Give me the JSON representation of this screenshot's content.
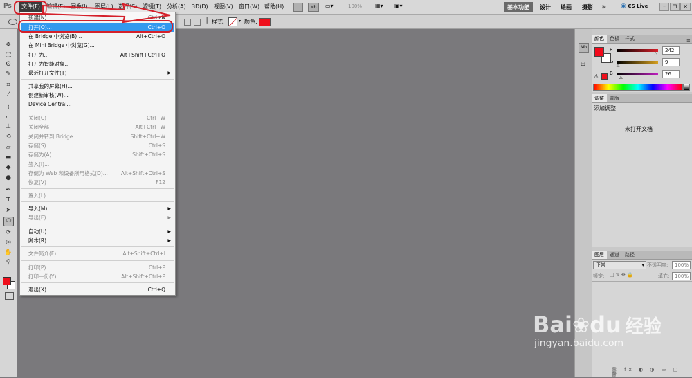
{
  "menubar": {
    "logo": "Ps",
    "menus": [
      "文件(F)",
      "编辑(E)",
      "图像(I)",
      "图层(L)",
      "选择(S)",
      "滤镜(T)",
      "分析(A)",
      "3D(D)",
      "视图(V)",
      "窗口(W)",
      "帮助(H)"
    ],
    "mb_label": "Mb",
    "zoom": "100%",
    "workspaces": [
      "基本功能",
      "设计",
      "绘画",
      "摄影"
    ],
    "more": "»",
    "cs_live": "CS Live"
  },
  "options_bar": {
    "style_label": "样式:",
    "color_label": "颜色:"
  },
  "file_menu": {
    "items": [
      {
        "label": "新建(N)...",
        "shortcut": "Ctrl+N",
        "disabled": false
      },
      {
        "label": "打开(O)...",
        "shortcut": "Ctrl+O",
        "disabled": false
      },
      {
        "label": "在 Bridge 中浏览(B)...",
        "shortcut": "Alt+Ctrl+O",
        "disabled": false
      },
      {
        "label": "在 Mini Bridge 中浏览(G)...",
        "shortcut": "",
        "disabled": false
      },
      {
        "label": "打开为...",
        "shortcut": "Alt+Shift+Ctrl+O",
        "disabled": false
      },
      {
        "label": "打开为智能对象...",
        "shortcut": "",
        "disabled": false
      },
      {
        "label": "最近打开文件(T)",
        "shortcut": "",
        "disabled": false,
        "submenu": true
      },
      {
        "label": "共享我的屏幕(H)...",
        "shortcut": "",
        "disabled": false
      },
      {
        "label": "创建新审核(W)...",
        "shortcut": "",
        "disabled": false
      },
      {
        "label": "Device Central...",
        "shortcut": "",
        "disabled": false
      },
      {
        "label": "关闭(C)",
        "shortcut": "Ctrl+W",
        "disabled": true
      },
      {
        "label": "关闭全部",
        "shortcut": "Alt+Ctrl+W",
        "disabled": true
      },
      {
        "label": "关闭并转到 Bridge...",
        "shortcut": "Shift+Ctrl+W",
        "disabled": true
      },
      {
        "label": "存储(S)",
        "shortcut": "Ctrl+S",
        "disabled": true
      },
      {
        "label": "存储为(A)...",
        "shortcut": "Shift+Ctrl+S",
        "disabled": true
      },
      {
        "label": "签入(I)...",
        "shortcut": "",
        "disabled": true
      },
      {
        "label": "存储为 Web 和设备所用格式(D)...",
        "shortcut": "Alt+Shift+Ctrl+S",
        "disabled": true
      },
      {
        "label": "恢复(V)",
        "shortcut": "F12",
        "disabled": true
      },
      {
        "label": "置入(L)...",
        "shortcut": "",
        "disabled": true
      },
      {
        "label": "导入(M)",
        "shortcut": "",
        "disabled": false,
        "submenu": true
      },
      {
        "label": "导出(E)",
        "shortcut": "",
        "disabled": true,
        "submenu": true
      },
      {
        "label": "自动(U)",
        "shortcut": "",
        "disabled": false,
        "submenu": true
      },
      {
        "label": "脚本(R)",
        "shortcut": "",
        "disabled": false,
        "submenu": true
      },
      {
        "label": "文件简介(F)...",
        "shortcut": "Alt+Shift+Ctrl+I",
        "disabled": true
      },
      {
        "label": "打印(P)...",
        "shortcut": "Ctrl+P",
        "disabled": true
      },
      {
        "label": "打印一份(Y)",
        "shortcut": "Alt+Shift+Ctrl+P",
        "disabled": true
      },
      {
        "label": "退出(X)",
        "shortcut": "Ctrl+Q",
        "disabled": false
      }
    ]
  },
  "color_panel": {
    "tabs": [
      "颜色",
      "色板",
      "样式"
    ],
    "channels": [
      {
        "name": "R",
        "value": "242",
        "color": "#d6202a"
      },
      {
        "name": "G",
        "value": "9",
        "color": "#d6a020"
      },
      {
        "name": "B",
        "value": "26",
        "color": "#c020c0"
      }
    ],
    "foreground": "#f2091a",
    "background": "#ffffff"
  },
  "adjust_panel": {
    "tabs": [
      "调整",
      "蒙版"
    ],
    "title": "添加调整",
    "empty": "未打开文档"
  },
  "layers_panel": {
    "tabs": [
      "图层",
      "通道",
      "路径"
    ],
    "blend_mode": "正常",
    "opacity_label": "不透明度:",
    "opacity_value": "100%",
    "lock_label": "锁定:",
    "fill_label": "填充:",
    "fill_value": "100%"
  },
  "watermark": {
    "brand": "Bai",
    "brand2": "du",
    "cn": "经验",
    "url": "jingyan.baidu.com"
  }
}
